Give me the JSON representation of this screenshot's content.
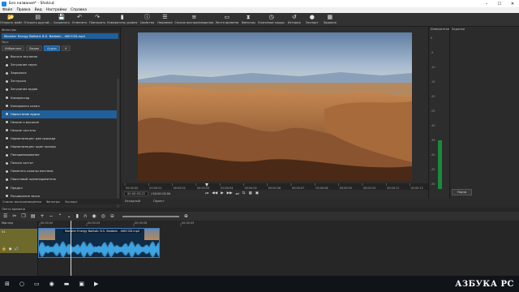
{
  "window": {
    "title": "Без названия* - Shotcut",
    "minimize": "–",
    "maximize": "☐",
    "close": "✕"
  },
  "menu": [
    "Файл",
    "Правка",
    "Вид",
    "Настройки",
    "Справка"
  ],
  "toolbar": [
    {
      "icon": "folder-open-icon",
      "glyph": "📂",
      "label": "Открыть файл"
    },
    {
      "icon": "open-other-icon",
      "glyph": "▤",
      "label": "Открыть другой..."
    },
    {
      "icon": "save-icon",
      "glyph": "💾",
      "label": "Сохранить"
    },
    {
      "icon": "undo-icon",
      "glyph": "↶",
      "label": "Отменить"
    },
    {
      "icon": "redo-icon",
      "glyph": "↷",
      "label": "Повторить"
    },
    {
      "icon": "peak-meter-icon",
      "glyph": "▮",
      "label": "Измеритель уровня"
    },
    {
      "icon": "properties-icon",
      "glyph": "ⓘ",
      "label": "Свойства"
    },
    {
      "icon": "recent-icon",
      "glyph": "☰",
      "label": "Недавние"
    },
    {
      "icon": "playlist-icon",
      "glyph": "≡",
      "label": "Список воспроизведения"
    },
    {
      "icon": "timeline-icon",
      "glyph": "▭",
      "label": "Лента времени"
    },
    {
      "icon": "filters-icon",
      "glyph": "⧗",
      "label": "Фильтры"
    },
    {
      "icon": "keyframes-icon",
      "glyph": "◷",
      "label": "Ключевые кадры"
    },
    {
      "icon": "history-icon",
      "glyph": "↺",
      "label": "История"
    },
    {
      "icon": "export-icon",
      "glyph": "●",
      "label": "Экспорт"
    },
    {
      "icon": "jobs-icon",
      "glyph": "▦",
      "label": "Задания"
    }
  ],
  "filters": {
    "panel_title": "Фильтры",
    "clip_name": "Monster Energy Ballistic B.S. Baldwin - 4KECOD.mp4",
    "search_label": "Звук",
    "tabs": [
      "Избранное",
      "Видео",
      "Аудио"
    ],
    "items": [
      "Высота звучания",
      "Затухание звука",
      "Задержка",
      "Заглушка",
      "Затухание аудио",
      "Компрессор",
      "Копировать канал",
      "Нарастание аудио",
      "Низкие и высокие",
      "Низкие частоты",
      "Нормализация: два прохода",
      "Нормализация: один проход",
      "Панорамирование",
      "Полоса частот",
      "Поменять каналы местами",
      "Пороговый шумоподавитель",
      "Предел",
      "Расширение звука"
    ],
    "selected_index": 7
  },
  "bottom_tabs": [
    "Список воспроизведения",
    "Фильтры",
    "Экспорт"
  ],
  "player": {
    "ruler_ticks": [
      "00:00:00",
      "00:00:01",
      "00:00:02",
      "00:00:03",
      "00:00:04",
      "00:00:05",
      "00:00:06",
      "00:00:07",
      "00:00:08",
      "00:00:09",
      "00:00:10",
      "00:00:11",
      "00:00:12"
    ],
    "current_tc": "00:00:03:22",
    "total_tc": "/ 00:00:13:00",
    "controls": [
      "⏮",
      "◀◀",
      "▶",
      "▶▶",
      "⏭",
      "⇆",
      "▦",
      "▣"
    ],
    "source_tab": "Исходный",
    "project_tab": "Проект"
  },
  "levels": {
    "title": "Измерители уровня",
    "scale": [
      "0",
      "-5",
      "-10",
      "-15",
      "-20",
      "-25",
      "-30",
      "-35",
      "-40",
      "-45",
      "-50"
    ]
  },
  "jobs": {
    "title": "Задания",
    "pause": "Пауза",
    "add": "Недавние",
    "clear": "Задания"
  },
  "timeline": {
    "title": "Лента времени",
    "master": "Мастер",
    "track": "V1",
    "ticks": [
      "00:00:00",
      "00:00:03",
      "00:00:06",
      "00:00:09"
    ],
    "clip_name": "Monster Energy Ballistic B.S. Baldwin - 4KECOD.mp4"
  },
  "taskbar": {
    "brand": "АЗБУКА РС"
  }
}
